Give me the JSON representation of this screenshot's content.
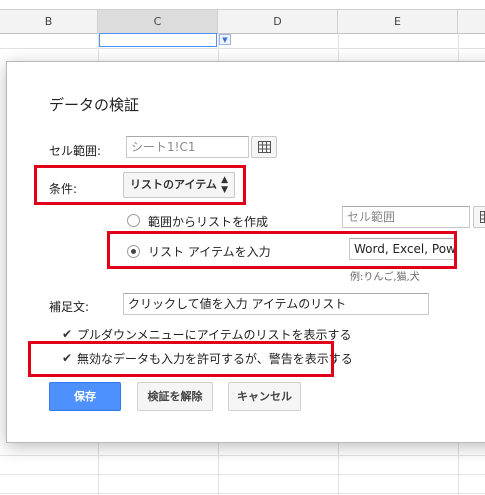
{
  "sheet": {
    "columns": [
      "B",
      "C",
      "D",
      "E"
    ]
  },
  "dialog": {
    "title": "データの検証",
    "cell_range": {
      "label": "セル範囲:",
      "value": "シート1!C1"
    },
    "criteria": {
      "label": "条件:",
      "selected": "リストのアイテム"
    },
    "options": {
      "from_range_label": "範囲からリストを作成",
      "range_placeholder": "セル範囲",
      "enter_items_label": "リスト アイテムを入力",
      "items_value": "Word, Excel, Pow",
      "example_hint": "例:りんご,猫,犬"
    },
    "help_text": {
      "label": "補足文:",
      "value": "クリックして値を入力 アイテムのリスト"
    },
    "checkboxes": {
      "show_dropdown": "プルダウンメニューにアイテムのリストを表示する",
      "allow_invalid": "無効なデータも入力を許可するが、警告を表示する"
    },
    "buttons": {
      "save": "保存",
      "remove": "検証を解除",
      "cancel": "キャンセル"
    }
  },
  "colors": {
    "accent": "#4d90fe",
    "highlight": "#e0001a"
  }
}
